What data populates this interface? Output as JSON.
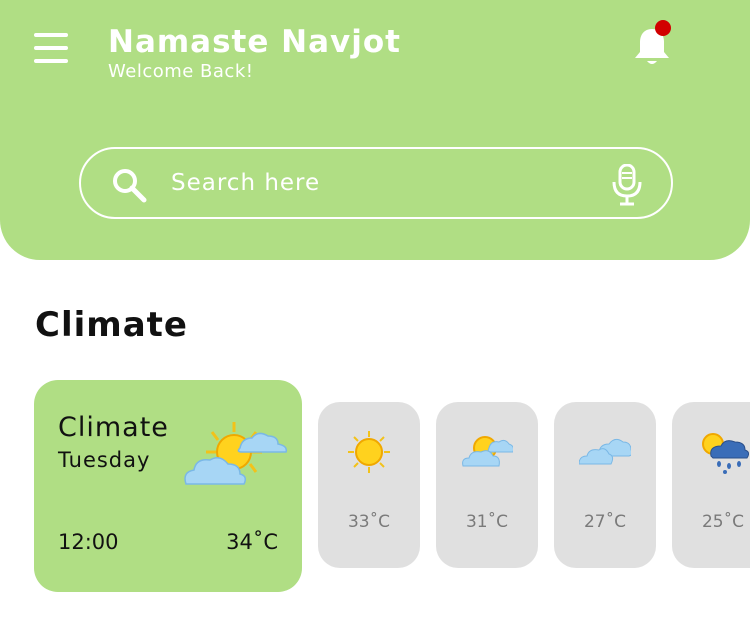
{
  "header": {
    "title": "Namaste Navjot",
    "subtitle": "Welcome Back!"
  },
  "search": {
    "placeholder": "Search here"
  },
  "section": {
    "title": "Climate"
  },
  "main_card": {
    "title": "Climate",
    "day": "Tuesday",
    "time": "12:00",
    "temp": "34˚C",
    "icon": "partly-cloudy-sun-icon"
  },
  "forecast": [
    {
      "temp": "33˚C",
      "icon": "sun-icon"
    },
    {
      "temp": "31˚C",
      "icon": "partly-cloudy-icon"
    },
    {
      "temp": "27˚C",
      "icon": "cloudy-icon"
    },
    {
      "temp": "25˚C",
      "icon": "rain-icon"
    }
  ],
  "colors": {
    "header_bg": "#b0de84",
    "card_active": "#b0de84",
    "card_inactive": "#e0e0e0",
    "notification_dot": "#d10000"
  }
}
